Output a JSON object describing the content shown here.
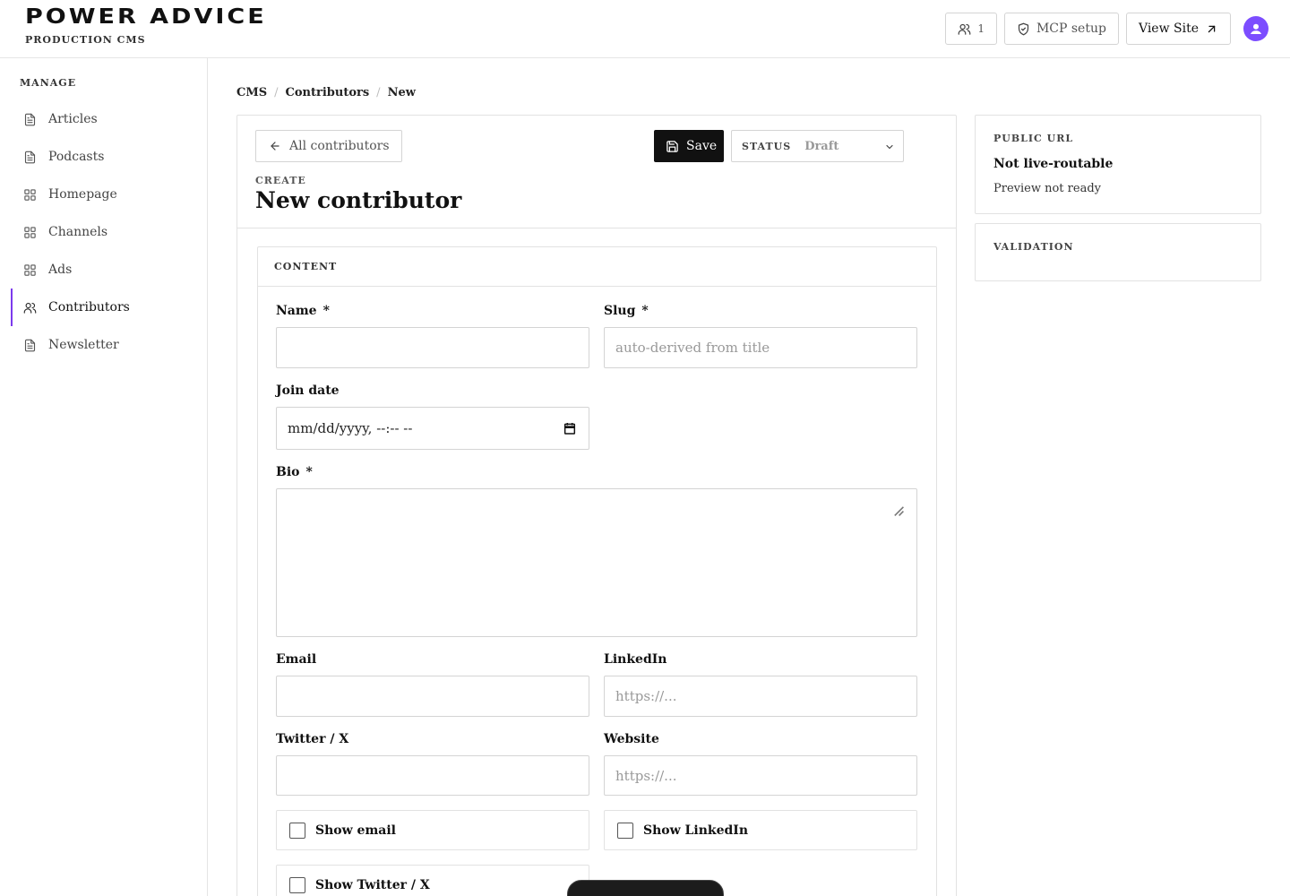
{
  "header": {
    "brand": "POWER ADVICE",
    "brand_sub": "PRODUCTION CMS",
    "users_count": "1",
    "mcp_label": "MCP setup",
    "view_site_label": "View Site"
  },
  "sidebar": {
    "heading": "MANAGE",
    "items": [
      {
        "label": "Articles",
        "icon": "document-icon"
      },
      {
        "label": "Podcasts",
        "icon": "document-icon"
      },
      {
        "label": "Homepage",
        "icon": "grid-icon"
      },
      {
        "label": "Channels",
        "icon": "grid-icon"
      },
      {
        "label": "Ads",
        "icon": "grid-icon"
      },
      {
        "label": "Contributors",
        "icon": "users-icon",
        "active": true
      },
      {
        "label": "Newsletter",
        "icon": "document-icon"
      }
    ]
  },
  "breadcrumb": [
    "CMS",
    "Contributors",
    "New"
  ],
  "editor": {
    "back_label": "All contributors",
    "save_label": "Save",
    "status_label": "STATUS",
    "status_value": "Draft",
    "create_label": "CREATE",
    "title": "New contributor",
    "section_title": "CONTENT",
    "fields": {
      "name": {
        "label": "Name",
        "required": "*",
        "value": ""
      },
      "slug": {
        "label": "Slug",
        "required": "*",
        "placeholder": "auto-derived from title"
      },
      "join_date": {
        "label": "Join date",
        "placeholder": "mm/dd/yyyy, --:-- --"
      },
      "bio": {
        "label": "Bio",
        "required": "*",
        "value": ""
      },
      "email": {
        "label": "Email",
        "value": ""
      },
      "linkedin": {
        "label": "LinkedIn",
        "placeholder": "https://..."
      },
      "twitter": {
        "label": "Twitter / X",
        "value": ""
      },
      "website": {
        "label": "Website",
        "placeholder": "https://..."
      }
    },
    "checkboxes": {
      "show_email": "Show email",
      "show_linkedin": "Show LinkedIn",
      "show_twitter": "Show Twitter / X"
    }
  },
  "public_url": {
    "title": "PUBLIC URL",
    "status": "Not live-routable",
    "note": "Preview not ready"
  },
  "validation": {
    "title": "VALIDATION"
  },
  "colors": {
    "accent": "#7c3aed",
    "avatar": "#7c4dff",
    "primary_button": "#111111"
  }
}
